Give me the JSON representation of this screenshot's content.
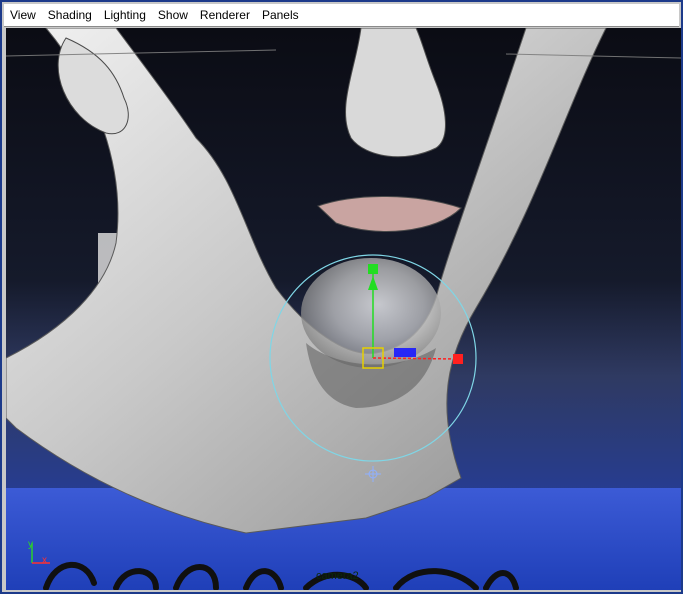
{
  "window": {
    "accent": "#1c3a8a"
  },
  "menubar": {
    "items": [
      "View",
      "Shading",
      "Lighting",
      "Show",
      "Renderer",
      "Panels"
    ]
  },
  "viewport": {
    "camera_label": "camera2",
    "axis_y_label": "y",
    "axis_x_label": "x",
    "gizmo_colors": {
      "ring": "#7fd6e6",
      "y_axis": "#22dd22",
      "x_axis": "#ff2020",
      "z_axis": "#1a1aff",
      "center": "#e6d000"
    }
  }
}
